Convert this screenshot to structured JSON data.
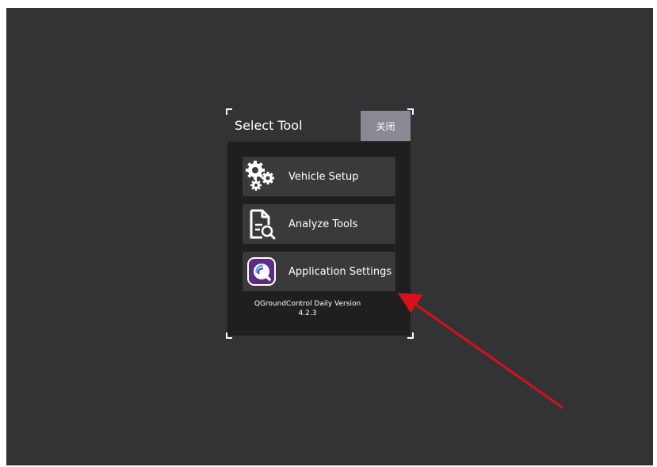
{
  "dialog": {
    "title": "Select Tool",
    "close_label": "关闭"
  },
  "tools": [
    {
      "label": "Vehicle Setup",
      "icon": "gears-icon"
    },
    {
      "label": "Analyze Tools",
      "icon": "document-magnifier-icon"
    },
    {
      "label": "Application Settings",
      "icon": "qgc-logo-icon"
    }
  ],
  "version": {
    "line1": "QGroundControl Daily Version",
    "line2": "4.2.3"
  },
  "colors": {
    "background": "#333234",
    "panel": "#1f1f1f",
    "item": "#3a3a3a",
    "close_button": "#8b8893",
    "annotation_arrow": "#d9101a"
  }
}
